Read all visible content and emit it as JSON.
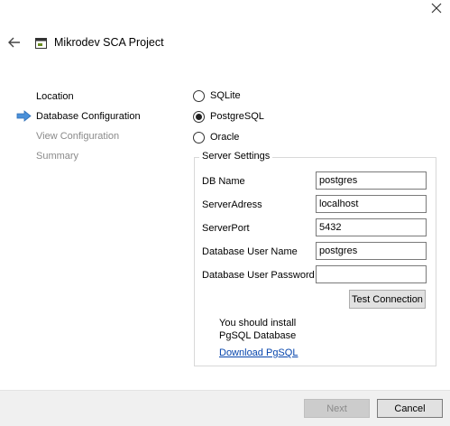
{
  "window": {
    "title": "Mikrodev SCA Project"
  },
  "steps": [
    {
      "label": "Location",
      "state": "done"
    },
    {
      "label": "Database Configuration",
      "state": "current"
    },
    {
      "label": "View Configuration",
      "state": "pending"
    },
    {
      "label": "Summary",
      "state": "pending"
    }
  ],
  "database_types": [
    {
      "label": "SQLite",
      "selected": false
    },
    {
      "label": "PostgreSQL",
      "selected": true
    },
    {
      "label": "Oracle",
      "selected": false
    }
  ],
  "server_settings": {
    "legend": "Server Settings",
    "db_name": {
      "label": "DB Name",
      "value": "postgres"
    },
    "server_address": {
      "label": "ServerAdress",
      "value": "localhost"
    },
    "server_port": {
      "label": "ServerPort",
      "value": "5432"
    },
    "db_user": {
      "label": "Database User Name",
      "value": "postgres"
    },
    "db_password": {
      "label": "Database User Password",
      "value": ""
    },
    "test_button": "Test Connection",
    "note_line1": "You should install",
    "note_line2": "PgSQL Database",
    "download_link": "Download PgSQL"
  },
  "footer": {
    "next_label": "Next",
    "cancel_label": "Cancel"
  },
  "colors": {
    "accent_arrow": "#4a90d9",
    "link": "#0645ad",
    "footer_bg": "#f0f0f0"
  },
  "icons": {
    "close": "close-icon",
    "back": "back-arrow-icon",
    "app": "app-window-icon",
    "current_step": "current-step-arrow-icon"
  }
}
